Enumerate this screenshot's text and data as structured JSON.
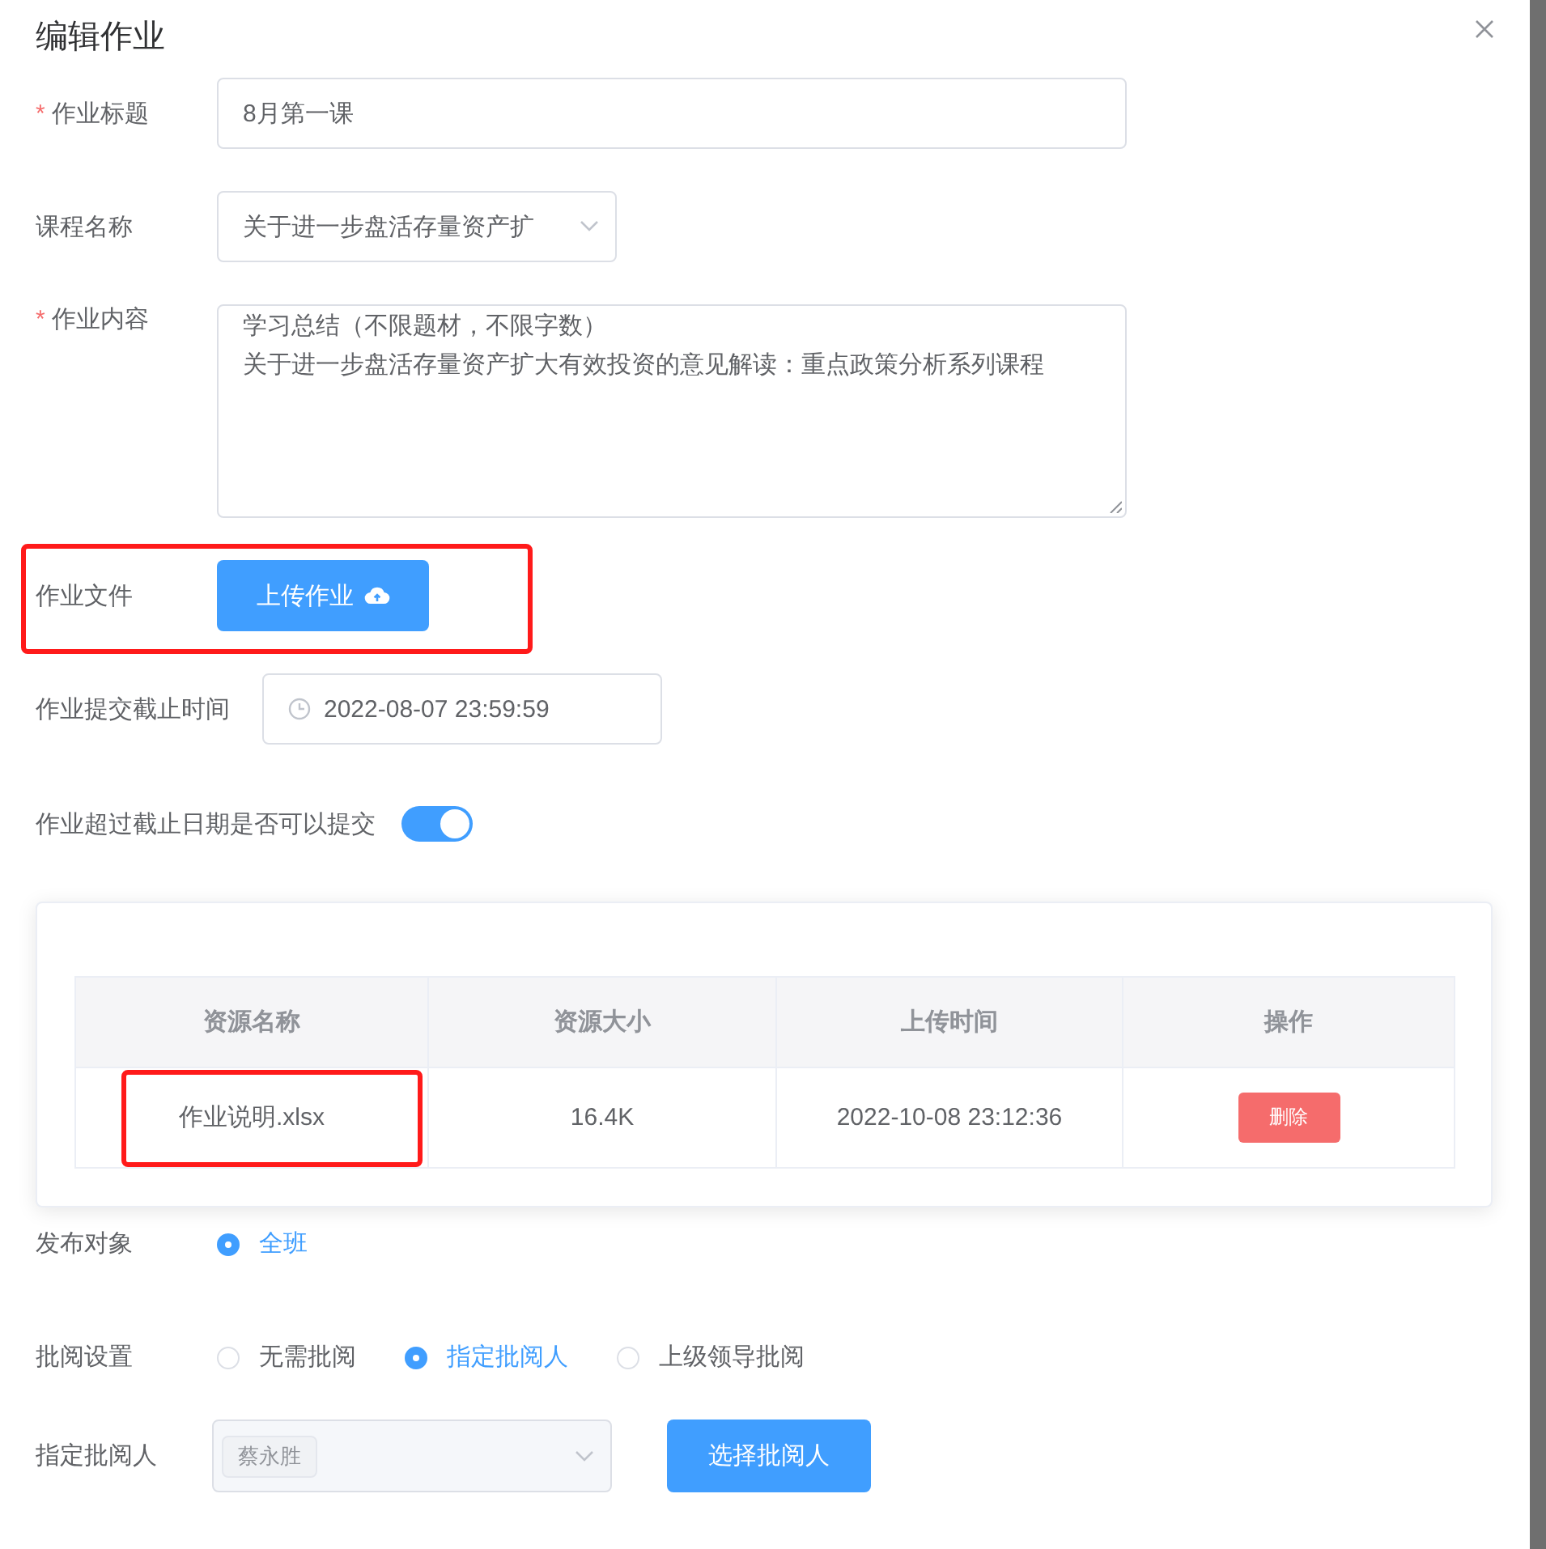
{
  "dialog": {
    "title": "编辑作业"
  },
  "title_field": {
    "required_mark": "*",
    "label": "作业标题",
    "value": "8月第一课"
  },
  "course_field": {
    "label": "课程名称",
    "value": "关于进一步盘活存量资产扩"
  },
  "content_field": {
    "required_mark": "*",
    "label": "作业内容",
    "lines": [
      "学习总结（不限题材，不限字数）",
      "关于进一步盘活存量资产扩大有效投资的意见解读：重点政策分析系列课程"
    ]
  },
  "file_field": {
    "label": "作业文件",
    "button": "上传作业",
    "highlighted": true
  },
  "deadline_field": {
    "label": "作业提交截止时间",
    "value": "2022-08-07 23:59:59"
  },
  "late_submit": {
    "label": "作业超过截止日期是否可以提交",
    "on": true
  },
  "files_table": {
    "columns": [
      "资源名称",
      "资源大小",
      "上传时间",
      "操作"
    ],
    "rows": [
      {
        "name": "作业说明.xlsx",
        "highlighted": true,
        "size": "16.4K",
        "uploaded": "2022-10-08 23:12:36",
        "action": "删除"
      }
    ]
  },
  "publish_target": {
    "label": "发布对象",
    "options": [
      {
        "label": "全班",
        "selected": true
      }
    ]
  },
  "review_setting": {
    "label": "批阅设置",
    "options": [
      {
        "label": "无需批阅",
        "selected": false
      },
      {
        "label": "指定批阅人",
        "selected": true
      },
      {
        "label": "上级领导批阅",
        "selected": false
      }
    ]
  },
  "reviewer": {
    "label": "指定批阅人",
    "tags": [
      "蔡永胜"
    ],
    "disabled": true,
    "button": "选择批阅人"
  }
}
